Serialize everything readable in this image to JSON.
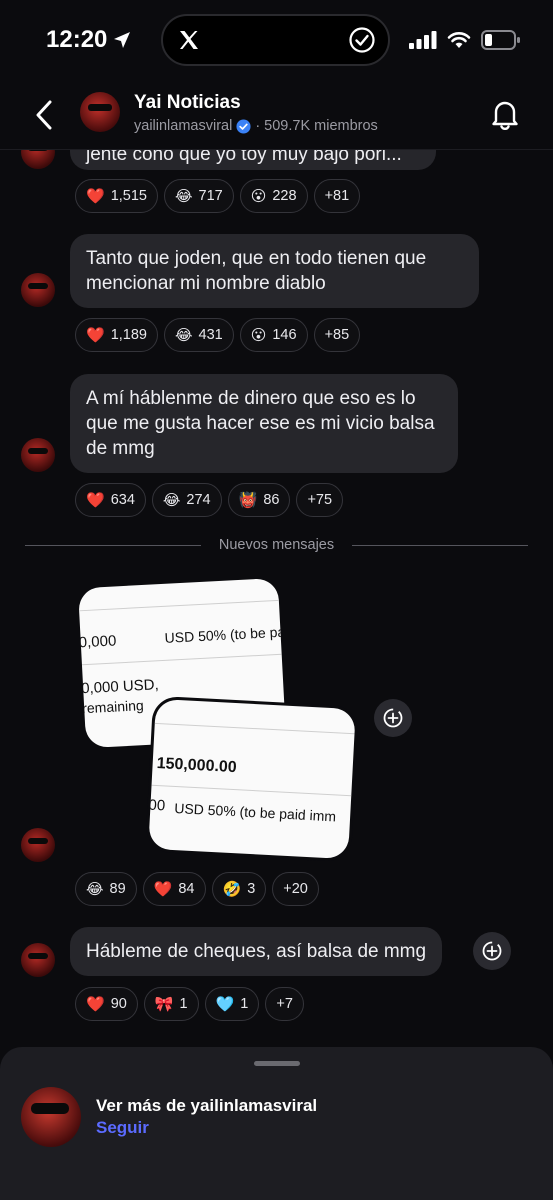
{
  "status_bar": {
    "time": "12:20"
  },
  "header": {
    "channel_name": "Yai Noticias",
    "handle": "yailinlamasviral",
    "members": "509.7K miembros"
  },
  "messages": [
    {
      "text": "jente cono que yo toy muy bajo pori...",
      "reactions": [
        {
          "emoji": "❤️",
          "count": "1,515"
        },
        {
          "emoji": "😂",
          "count": "717"
        },
        {
          "emoji": "😮",
          "count": "228"
        },
        {
          "emoji": "",
          "count": "+81"
        }
      ]
    },
    {
      "text": "Tanto que joden, que en todo tienen  que mencionar mi nombre diablo",
      "reactions": [
        {
          "emoji": "❤️",
          "count": "1,189"
        },
        {
          "emoji": "😂",
          "count": "431"
        },
        {
          "emoji": "😮",
          "count": "146"
        },
        {
          "emoji": "",
          "count": "+85"
        }
      ]
    },
    {
      "text": "A mí háblenme de dinero que eso es lo que me gusta hacer  ese es mi vicio balsa de mmg",
      "reactions": [
        {
          "emoji": "❤️",
          "count": "634"
        },
        {
          "emoji": "😂",
          "count": "274"
        },
        {
          "emoji": "👹",
          "count": "86"
        },
        {
          "emoji": "",
          "count": "+75"
        }
      ]
    }
  ],
  "divider_label": "Nuevos mensajes",
  "image_post": {
    "image1_lines": [
      "0,000",
      "USD 50% (to be pa",
      "0,000 USD,",
      "remaining"
    ],
    "image2_lines": [
      "150,000.00",
      "00",
      "USD 50% (to be paid imm"
    ],
    "reactions": [
      {
        "emoji": "😂",
        "count": "89"
      },
      {
        "emoji": "❤️",
        "count": "84"
      },
      {
        "emoji": "🤣",
        "count": "3"
      },
      {
        "emoji": "",
        "count": "+20"
      }
    ]
  },
  "last_message": {
    "text": "Hábleme de cheques, así balsa de mmg",
    "reactions": [
      {
        "emoji": "❤️",
        "count": "90"
      },
      {
        "emoji": "🎀",
        "count": "1"
      },
      {
        "emoji": "🩵",
        "count": "1"
      },
      {
        "emoji": "",
        "count": "+7"
      }
    ]
  },
  "sheet": {
    "title": "Ver más de yailinlamasviral",
    "follow_label": "Seguir"
  },
  "colors": {
    "background": "#0b0b0e",
    "bubble": "#26262b",
    "follow_accent": "#5b6bff",
    "verified": "#3b82f6"
  },
  "icons": [
    "location-arrow-icon",
    "x-logo-icon",
    "check-circle-icon",
    "signal-icon",
    "wifi-icon",
    "battery-icon",
    "back-chevron-icon",
    "verified-badge-icon",
    "bell-icon",
    "share-icon"
  ]
}
